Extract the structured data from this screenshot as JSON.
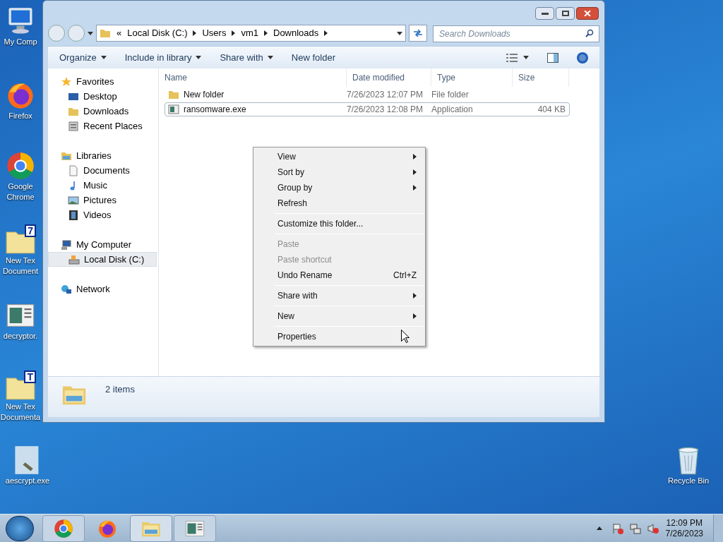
{
  "desktop_icons": [
    {
      "kind": "computer",
      "label": [
        "My Comp"
      ]
    },
    {
      "kind": "firefox",
      "label": [
        "Firefox"
      ]
    },
    {
      "kind": "chrome",
      "label": [
        "Google",
        "Chrome"
      ]
    },
    {
      "kind": "textdoc",
      "badge": "7",
      "label": [
        "New Tex",
        "Document"
      ]
    },
    {
      "kind": "app",
      "label": [
        "decryptor."
      ]
    },
    {
      "kind": "textdoc",
      "badge": "T",
      "label": [
        "New Tex",
        "Documenta"
      ]
    },
    {
      "kind": "aes",
      "label": [
        "aescrypt.exe"
      ]
    },
    {
      "kind": "recycle",
      "label": [
        "Recycle Bin"
      ]
    }
  ],
  "window": {
    "address": {
      "prefix": "«",
      "segments": [
        "Local Disk (C:)",
        "Users",
        "vm1",
        "Downloads"
      ]
    },
    "search": {
      "placeholder": "Search Downloads"
    },
    "toolbar": [
      {
        "label": "Organize",
        "dropdown": true
      },
      {
        "label": "Include in library",
        "dropdown": true
      },
      {
        "label": "Share with",
        "dropdown": true
      },
      {
        "label": "New folder",
        "dropdown": false
      }
    ],
    "sidebar": [
      {
        "kind": "favorites",
        "label": "Favorites",
        "selected": false,
        "children": [
          {
            "kind": "desktop",
            "label": "Desktop",
            "selected": false
          },
          {
            "kind": "downloads",
            "label": "Downloads",
            "selected": false
          },
          {
            "kind": "recent",
            "label": "Recent Places",
            "selected": false
          }
        ]
      },
      {
        "kind": "libraries",
        "label": "Libraries",
        "selected": false,
        "children": [
          {
            "kind": "documents",
            "label": "Documents",
            "selected": false
          },
          {
            "kind": "music",
            "label": "Music",
            "selected": false
          },
          {
            "kind": "pictures",
            "label": "Pictures",
            "selected": false
          },
          {
            "kind": "videos",
            "label": "Videos",
            "selected": false
          }
        ]
      },
      {
        "kind": "computer",
        "label": "My Computer",
        "selected": false,
        "children": [
          {
            "kind": "disk",
            "label": "Local Disk (C:)",
            "selected": true
          }
        ]
      },
      {
        "kind": "network",
        "label": "Network",
        "selected": false
      }
    ],
    "columns": [
      "Name",
      "Date modified",
      "Type",
      "Size"
    ],
    "rows": [
      {
        "kind": "folder",
        "name": "New folder",
        "date": "7/26/2023 12:07 PM",
        "type": "File folder",
        "size": "",
        "selected": false
      },
      {
        "kind": "app",
        "name": "ransomware.exe",
        "date": "7/26/2023 12:08 PM",
        "type": "Application",
        "size": "404 KB",
        "selected": true
      }
    ],
    "status": "2 items"
  },
  "context_menu": [
    {
      "kind": "item",
      "label": "View",
      "submenu": true,
      "disabled": false
    },
    {
      "kind": "item",
      "label": "Sort by",
      "submenu": true,
      "disabled": false
    },
    {
      "kind": "item",
      "label": "Group by",
      "submenu": true,
      "disabled": false
    },
    {
      "kind": "item",
      "label": "Refresh",
      "submenu": false,
      "disabled": false
    },
    {
      "kind": "separator"
    },
    {
      "kind": "item",
      "label": "Customize this folder...",
      "submenu": false,
      "disabled": false
    },
    {
      "kind": "separator"
    },
    {
      "kind": "item",
      "label": "Paste",
      "submenu": false,
      "disabled": true
    },
    {
      "kind": "item",
      "label": "Paste shortcut",
      "submenu": false,
      "disabled": true
    },
    {
      "kind": "item",
      "label": "Undo Rename",
      "shortcut": "Ctrl+Z",
      "submenu": false,
      "disabled": false
    },
    {
      "kind": "separator"
    },
    {
      "kind": "item",
      "label": "Share with",
      "submenu": true,
      "disabled": false
    },
    {
      "kind": "separator"
    },
    {
      "kind": "item",
      "label": "New",
      "submenu": true,
      "disabled": false
    },
    {
      "kind": "separator"
    },
    {
      "kind": "item",
      "label": "Properties",
      "submenu": false,
      "disabled": false
    }
  ],
  "taskbar": {
    "apps": [
      {
        "kind": "chrome",
        "selected": false
      },
      {
        "kind": "firefox",
        "selected": false
      },
      {
        "kind": "explorer",
        "selected": true
      },
      {
        "kind": "app",
        "selected": false
      }
    ],
    "time": "12:09 PM",
    "date": "7/26/2023"
  }
}
